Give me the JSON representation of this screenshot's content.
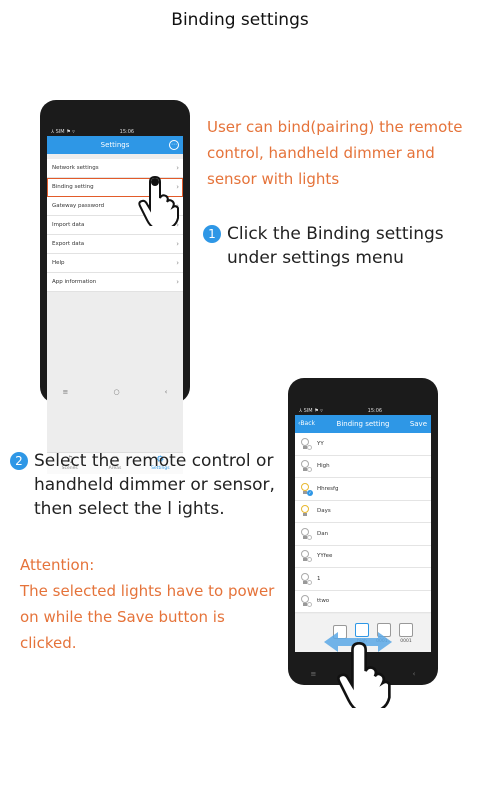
{
  "page": {
    "title": "Binding settings"
  },
  "intro_text": "User can bind(pairing) the remote control, handheld dimmer  and sensor with lights",
  "step1": {
    "number": "1",
    "text": "Click the Binding settings under settings menu"
  },
  "step2": {
    "number": "2",
    "text": "Select the remote control or handheld dimmer or sensor, then select the l ights."
  },
  "attention": {
    "title": "Attention:",
    "text": "The selected lights have to power on while the Save button is clicked."
  },
  "phone1": {
    "status_left": "⅄ SIM ⚑ ▿",
    "status_time": "15:06",
    "appbar_title": "Settings",
    "menu": [
      {
        "label": "Network settings"
      },
      {
        "label": "Binding setting"
      },
      {
        "label": "Gateway password"
      },
      {
        "label": "Import data"
      },
      {
        "label": "Export data"
      },
      {
        "label": "Help"
      },
      {
        "label": "App information"
      }
    ],
    "tabs": [
      {
        "label": "Scenes",
        "icon": "♫"
      },
      {
        "label": "Areas",
        "icon": "∷"
      },
      {
        "label": "Settings",
        "icon": "⚙"
      }
    ],
    "softkeys": [
      "≡",
      "○",
      "‹"
    ]
  },
  "phone2": {
    "status_left": "⅄ SIM ⚑ ▿",
    "status_time": "15:06",
    "back_label": "‹Back",
    "appbar_title": "Binding setting",
    "save_label": "Save",
    "lights": [
      {
        "name": "YY",
        "selected": false
      },
      {
        "name": "High",
        "selected": false
      },
      {
        "name": "Hhresfg",
        "selected": true
      },
      {
        "name": "Days",
        "selected": false
      },
      {
        "name": "Dan",
        "selected": false
      },
      {
        "name": "YYfee",
        "selected": false
      },
      {
        "name": "1",
        "selected": false
      },
      {
        "name": "ttwo",
        "selected": false
      }
    ],
    "devices": [
      {
        "label": "",
        "selected": false
      },
      {
        "label": "high",
        "selected": true
      },
      {
        "label": "0001...",
        "selected": false
      },
      {
        "label": "0001",
        "selected": false
      }
    ],
    "softkeys": [
      "≡",
      "○",
      "‹"
    ]
  },
  "colors": {
    "accent": "#2e97e6",
    "orange": "#e5733a",
    "highlight": "#e25b2a"
  }
}
